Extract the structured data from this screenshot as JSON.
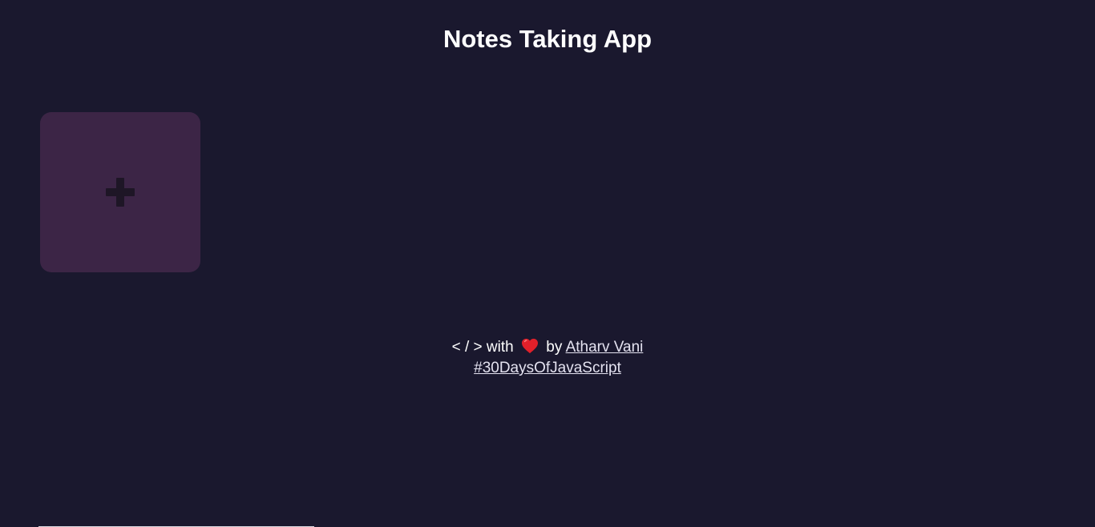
{
  "header": {
    "title": "Notes Taking App"
  },
  "notes": {
    "add_icon": "plus-icon"
  },
  "footer": {
    "code_symbol": "< / >",
    "with_text": "with",
    "heart_icon": "heart-icon",
    "by_text": "by",
    "author_link": "Atharv Vani",
    "hashtag_link": "#30DaysOfJavaScript"
  },
  "colors": {
    "background": "#1a182e",
    "add_card": "#3c2546",
    "plus": "#1e1626",
    "heart": "#e0202a"
  }
}
